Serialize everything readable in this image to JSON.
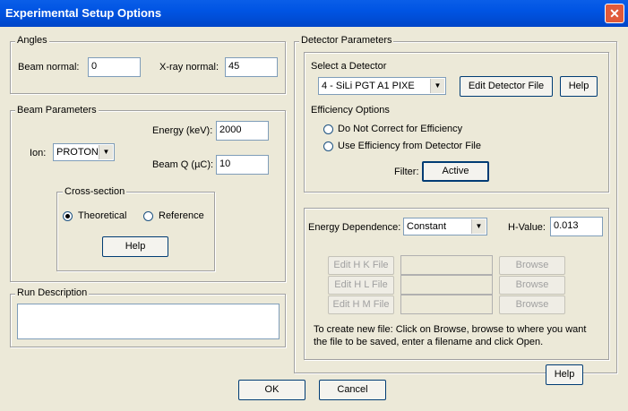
{
  "window": {
    "title": "Experimental Setup Options",
    "close_glyph": "✕"
  },
  "angles": {
    "legend": "Angles",
    "beam_normal_label": "Beam normal:",
    "beam_normal_value": "0",
    "xray_normal_label": "X-ray normal:",
    "xray_normal_value": "45"
  },
  "beam": {
    "legend": "Beam Parameters",
    "energy_label": "Energy (keV):",
    "energy_value": "2000",
    "ion_label": "Ion:",
    "ion_value": "PROTON",
    "beamq_label": "Beam Q (µC):",
    "beamq_value": "10",
    "cross_section": {
      "legend": "Cross-section",
      "theoretical_label": "Theoretical",
      "reference_label": "Reference",
      "help_label": "Help"
    }
  },
  "run": {
    "legend": "Run Description",
    "value": ""
  },
  "detector": {
    "legend": "Detector Parameters",
    "select_label": "Select a Detector",
    "detector_value": "4 - SiLi PGT A1 PIXE",
    "edit_button": "Edit Detector File",
    "help_button": "Help",
    "efficiency_label": "Efficiency Options",
    "opt_no_correct": "Do Not Correct for Efficiency",
    "opt_use_file": "Use Efficiency from Detector File",
    "filter_label": "Filter:",
    "filter_button": "Active"
  },
  "energy_dep": {
    "label": "Energy Dependence:",
    "value": "Constant",
    "hvalue_label": "H-Value:",
    "hvalue": "0.013",
    "edit_hk": "Edit H K File",
    "edit_hl": "Edit H L File",
    "edit_hm": "Edit H M File",
    "browse": "Browse",
    "instructions_line1": "To create new file: Click on Browse, browse to where you want",
    "instructions_line2": "the file to be saved, enter a filename and click Open."
  },
  "footer": {
    "help": "Help",
    "ok": "OK",
    "cancel": "Cancel"
  }
}
